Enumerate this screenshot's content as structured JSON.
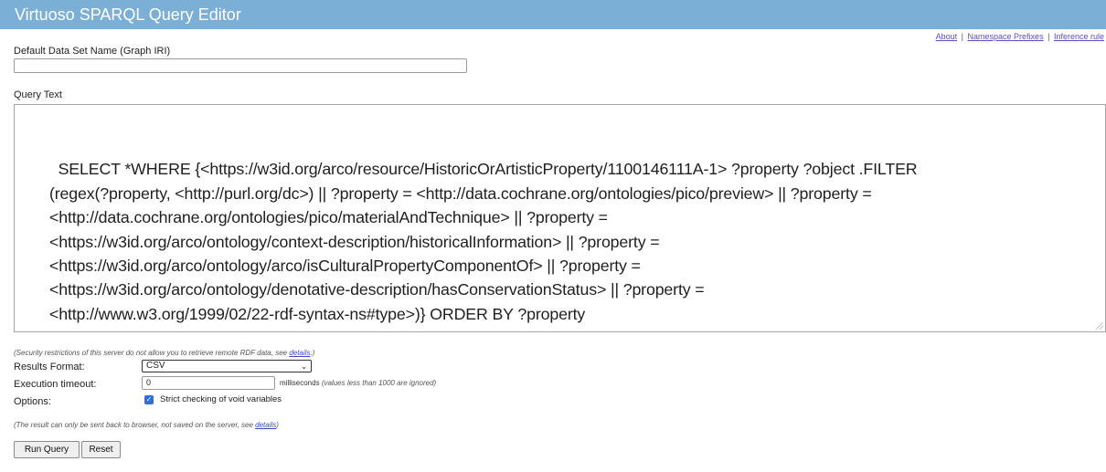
{
  "header": {
    "title": "Virtuoso SPARQL Query Editor"
  },
  "top_links": {
    "about": "About",
    "namespace_prefixes": "Namespace Prefixes",
    "inference_rules": "Inference rule",
    "separator": "|"
  },
  "graph": {
    "label": "Default Data Set Name (Graph IRI)",
    "value": ""
  },
  "query": {
    "label": "Query Text",
    "text": "SELECT *WHERE {<https://w3id.org/arco/resource/HistoricOrArtisticProperty/1100146111A-1> ?property ?object .FILTER\n(regex(?property, <http://purl.org/dc>) || ?property = <http://data.cochrane.org/ontologies/pico/preview> || ?property =\n<http://data.cochrane.org/ontologies/pico/materialAndTechnique> || ?property =\n<https://w3id.org/arco/ontology/context-description/historicalInformation> || ?property =\n<https://w3id.org/arco/ontology/arco/isCulturalPropertyComponentOf> || ?property =\n<https://w3id.org/arco/ontology/denotative-description/hasConservationStatus> || ?property =\n<http://www.w3.org/1999/02/22-rdf-syntax-ns#type>)} ORDER BY ?property"
  },
  "security_note": {
    "prefix": "(Security restrictions of this server do not allow you to retrieve remote RDF data, see ",
    "link": "details",
    "suffix": ".)"
  },
  "results_format": {
    "label": "Results Format:",
    "selected": "CSV"
  },
  "timeout": {
    "label": "Execution timeout:",
    "value": "0",
    "unit": "milliseconds",
    "note": "(values less than 1000 are ignored)"
  },
  "options": {
    "label": "Options:",
    "checkbox_label": "Strict checking of void variables",
    "checked": true
  },
  "result_note": {
    "prefix": "(The result can only be sent back to browser, not saved on the server, see ",
    "link": "details",
    "suffix": ")"
  },
  "buttons": {
    "run": "Run Query",
    "reset": "Reset"
  },
  "colors": {
    "titlebar": "#7cafd6",
    "link": "#5a4fc3",
    "checkbox": "#2f6fd6"
  }
}
